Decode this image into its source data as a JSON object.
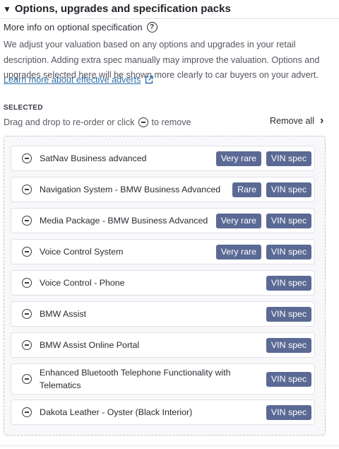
{
  "header": {
    "title": "Options, upgrades and specification packs"
  },
  "more_info": {
    "label": "More info on optional specification",
    "icon": "help-icon"
  },
  "description": "We adjust your valuation based on any options and upgrades in your retail description. Adding extra spec manually may improve the valuation. Options and upgrades selected here will be shown more clearly to car buyers on your advert.",
  "learn_more": {
    "label": "Learn more about effective adverts",
    "icon": "external-link-icon"
  },
  "selected": {
    "label": "SELECTED",
    "hint_before": "Drag and drop to re-order or click",
    "hint_after": "to remove",
    "remove_all": "Remove all"
  },
  "items": [
    {
      "name": "SatNav Business advanced",
      "rarity": "Very rare",
      "spec": "VIN spec"
    },
    {
      "name": "Navigation System - BMW Business Advanced",
      "rarity": "Rare",
      "spec": "VIN spec"
    },
    {
      "name": "Media Package - BMW Business Advanced",
      "rarity": "Very rare",
      "spec": "VIN spec"
    },
    {
      "name": "Voice Control System",
      "rarity": "Very rare",
      "spec": "VIN spec"
    },
    {
      "name": "Voice Control - Phone",
      "rarity": "",
      "spec": "VIN spec"
    },
    {
      "name": "BMW Assist",
      "rarity": "",
      "spec": "VIN spec"
    },
    {
      "name": "BMW Assist Online Portal",
      "rarity": "",
      "spec": "VIN spec"
    },
    {
      "name": "Enhanced Bluetooth Telephone Functionality with Telematics",
      "rarity": "",
      "spec": "VIN spec"
    },
    {
      "name": "Dakota Leather - Oyster (Black Interior)",
      "rarity": "",
      "spec": "VIN spec"
    }
  ],
  "colors": {
    "badge": "#5b6a94",
    "link": "#2d6fa8",
    "text": "#2b2b33"
  }
}
